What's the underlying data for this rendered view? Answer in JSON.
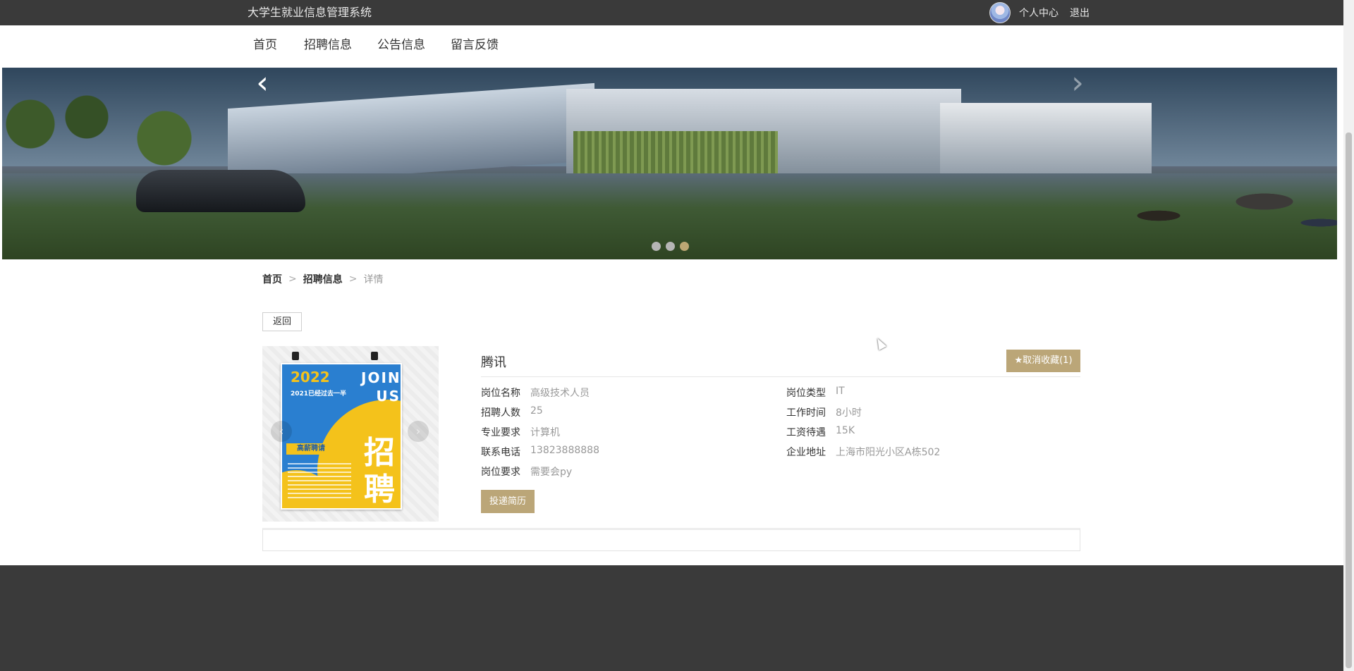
{
  "header": {
    "site_title": "大学生就业信息管理系统",
    "profile_link": "个人中心",
    "logout_link": "退出"
  },
  "nav": {
    "items": [
      {
        "label": "首页"
      },
      {
        "label": "招聘信息"
      },
      {
        "label": "公告信息"
      },
      {
        "label": "留言反馈"
      }
    ]
  },
  "banner": {
    "prev_icon": "‹",
    "next_icon": "›",
    "slide_count": 3,
    "active_slide": 3
  },
  "breadcrumb": {
    "home": "首页",
    "section": "招聘信息",
    "current": "详情",
    "separator": ">"
  },
  "back_button": "返回",
  "poster": {
    "year": "2022",
    "join": "JOIN US",
    "subtitle": "2021已经过去一半",
    "tag": "高薪聘请",
    "big_text": "招聘"
  },
  "job": {
    "company": "腾讯",
    "favorite_button": "★取消收藏(1)",
    "fields_left": [
      {
        "label": "岗位名称",
        "value": "高级技术人员"
      },
      {
        "label": "招聘人数",
        "value": "25"
      },
      {
        "label": "专业要求",
        "value": "计算机"
      },
      {
        "label": "联系电话",
        "value": "13823888888"
      },
      {
        "label": "岗位要求",
        "value": "需要会py"
      }
    ],
    "fields_right": [
      {
        "label": "岗位类型",
        "value": "IT"
      },
      {
        "label": "工作时间",
        "value": "8小时"
      },
      {
        "label": "工资待遇",
        "value": "15K"
      },
      {
        "label": "企业地址",
        "value": "上海市阳光小区A栋502"
      }
    ],
    "apply_button": "投递简历"
  },
  "colors": {
    "topbar": "#3a3a3a",
    "accent": "#bba678",
    "dot_active": "#bda774"
  }
}
